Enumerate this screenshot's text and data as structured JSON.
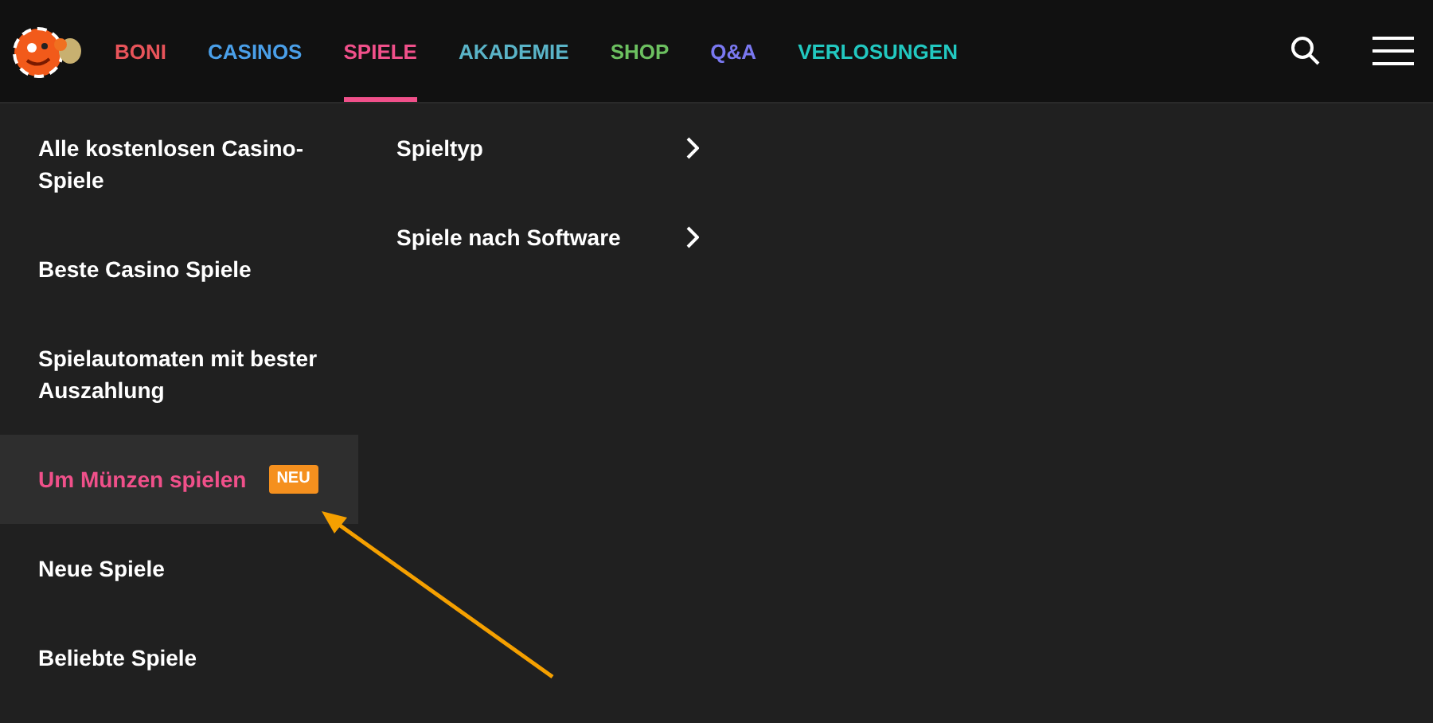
{
  "nav": [
    {
      "label": "BONI",
      "color": "#e8545a",
      "selected": false
    },
    {
      "label": "CASINOS",
      "color": "#4a9fe8",
      "selected": false
    },
    {
      "label": "SPIELE",
      "color": "#f0508a",
      "selected": true
    },
    {
      "label": "AKADEMIE",
      "color": "#5ab4c8",
      "selected": false
    },
    {
      "label": "SHOP",
      "color": "#6cc060",
      "selected": false
    },
    {
      "label": "Q&A",
      "color": "#7a78f0",
      "selected": false
    },
    {
      "label": "VERLOSUNGEN",
      "color": "#22c8c0",
      "selected": false
    }
  ],
  "menu": [
    {
      "label": "Alle kostenlosen Casino-Spiele",
      "selected": false
    },
    {
      "label": "Beste Casino Spiele",
      "selected": false
    },
    {
      "label": "Spielautomaten mit bester Auszahlung",
      "selected": false
    },
    {
      "label": "Um Münzen spielen",
      "selected": true,
      "badge": "NEU"
    },
    {
      "label": "Neue Spiele",
      "selected": false
    },
    {
      "label": "Beliebte Spiele",
      "selected": false
    }
  ],
  "submenu": [
    {
      "label": "Spieltyp"
    },
    {
      "label": "Spiele nach Software"
    }
  ]
}
